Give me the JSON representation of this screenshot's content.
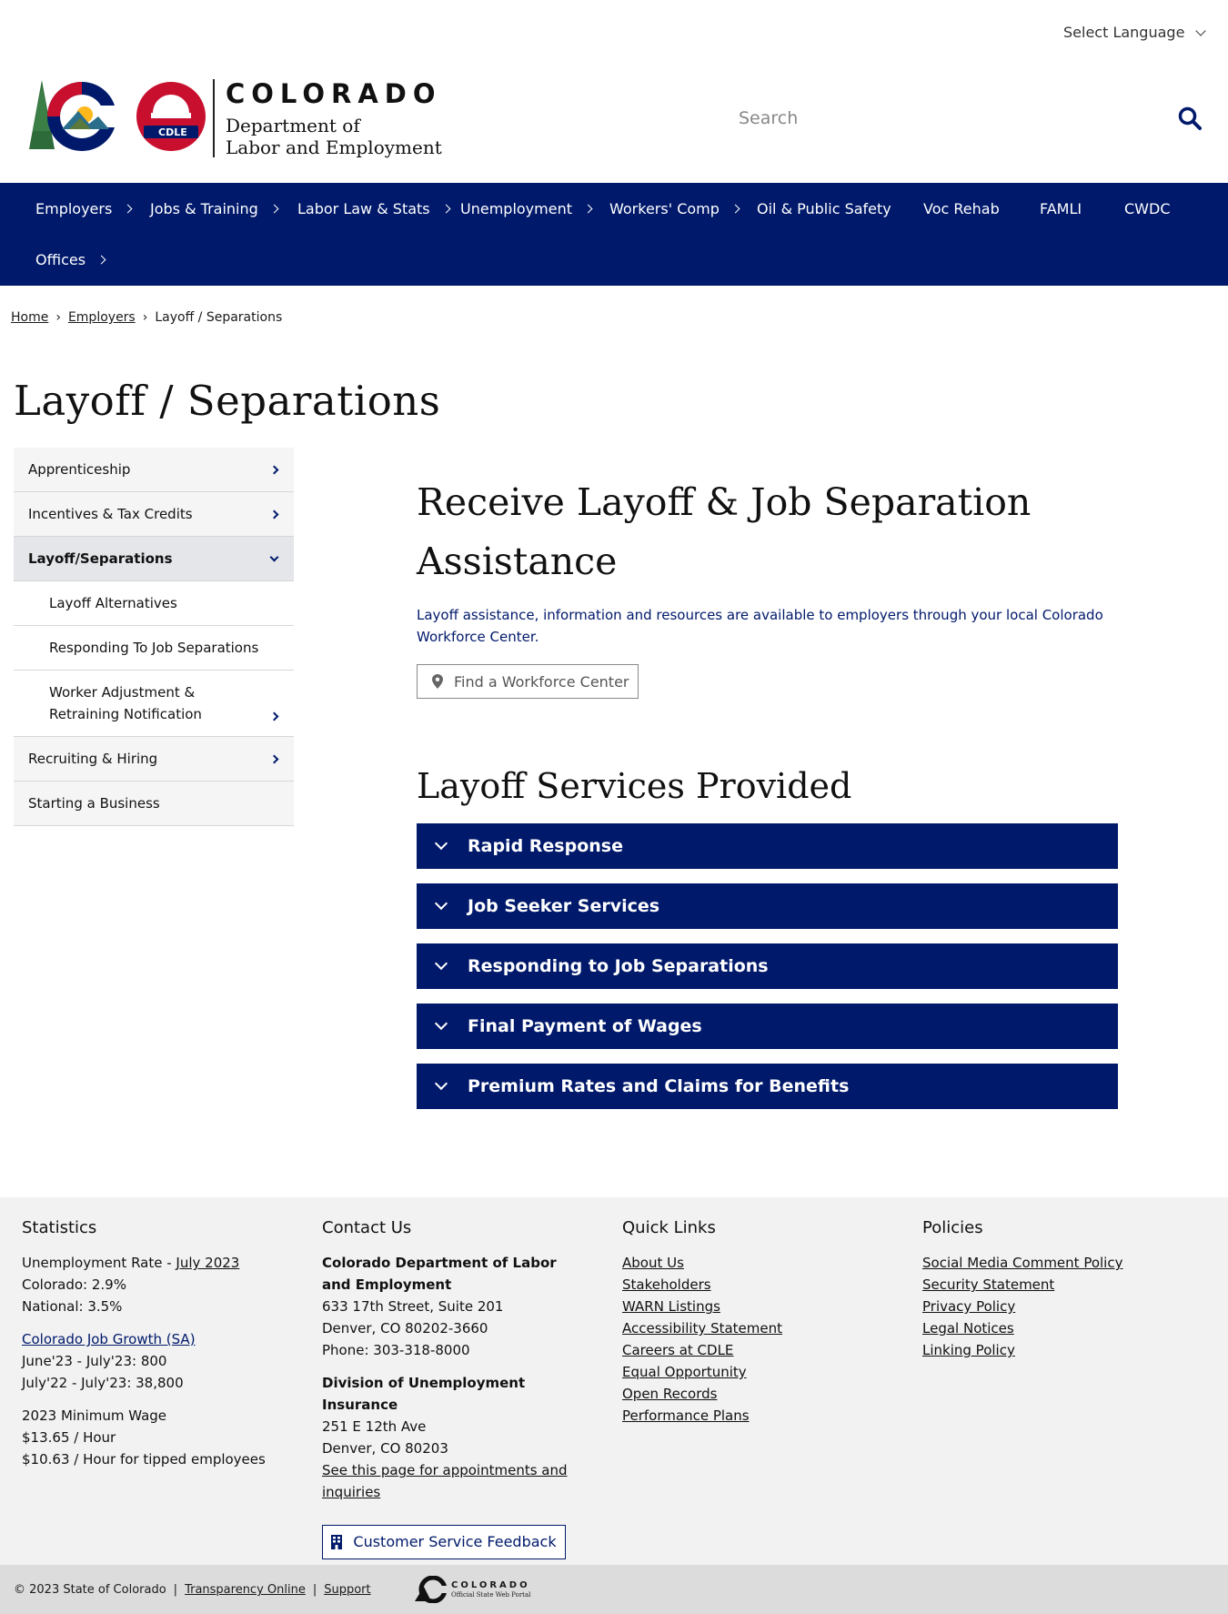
{
  "header": {
    "language_label": "Select Language",
    "logo_title": "COLORADO",
    "logo_sub_line1": "Department of",
    "logo_sub_line2": "Labor and Employment",
    "logo_badge": "CDLE",
    "search_placeholder": "Search"
  },
  "nav": {
    "items": [
      {
        "label": "Employers"
      },
      {
        "label": "Jobs & Training"
      },
      {
        "label": "Labor Law & Stats"
      },
      {
        "label": "Unemployment"
      },
      {
        "label": "Workers' Comp"
      },
      {
        "label": "Oil & Public Safety"
      },
      {
        "label": "Voc Rehab"
      },
      {
        "label": "FAMLI"
      },
      {
        "label": "CWDC"
      },
      {
        "label": "Offices"
      }
    ]
  },
  "breadcrumb": {
    "home": "Home",
    "employers": "Employers",
    "current": "Layoff / Separations"
  },
  "page_title": "Layoff / Separations",
  "sidebar": {
    "items": [
      {
        "label": "Apprenticeship"
      },
      {
        "label": "Incentives & Tax Credits"
      },
      {
        "label": "Layoff/Separations"
      },
      {
        "label": "Layoff Alternatives"
      },
      {
        "label": "Responding To Job Separations"
      },
      {
        "label": "Worker Adjustment & Retraining Notification"
      },
      {
        "label": "Recruiting & Hiring"
      },
      {
        "label": "Starting a Business"
      }
    ]
  },
  "main": {
    "heading": "Receive Layoff & Job Separation Assistance",
    "lead": "Layoff assistance, information and resources are available to employers through your local Colorado Workforce Center.",
    "find_button": "Find a Workforce Center",
    "services_heading": "Layoff Services Provided",
    "accordion": [
      {
        "label": "Rapid Response"
      },
      {
        "label": "Job Seeker Services"
      },
      {
        "label": "Responding to Job Separations"
      },
      {
        "label": "Final Payment of Wages"
      },
      {
        "label": "Premium Rates and Claims for Benefits"
      }
    ]
  },
  "footer": {
    "statistics": {
      "heading": "Statistics",
      "unemp_label": "Unemployment Rate - ",
      "unemp_link": "July 2023",
      "colorado": "Colorado: 2.9%",
      "national": "National: 3.5%",
      "growth_link": "Colorado Job Growth (SA)",
      "growth_1": "June'23 - July'23: 800",
      "growth_2": "July'22 - July'23: 38,800",
      "minwage_label": "2023 Minimum Wage",
      "minwage_1": "$13.65 / Hour",
      "minwage_2": "$10.63 / Hour for tipped employees"
    },
    "contact": {
      "heading": "Contact Us",
      "org": "Colorado Department of Labor and Employment",
      "addr1": "633 17th Street, Suite 201",
      "addr2": "Denver, CO  80202-3660",
      "phone": "Phone: 303-318-8000",
      "div": "Division of Unemployment Insurance",
      "div_addr1": "251 E 12th Ave",
      "div_addr2": "Denver, CO  80203",
      "appt_link": "See this page for appointments and inquiries",
      "feedback_button": "Customer Service Feedback"
    },
    "quick_links": {
      "heading": "Quick Links",
      "links": [
        "About Us",
        "Stakeholders",
        "WARN Listings",
        "Accessibility Statement",
        "Careers at CDLE",
        "Equal Opportunity",
        "Open Records",
        "Performance Plans"
      ]
    },
    "policies": {
      "heading": "Policies",
      "links": [
        "Social Media Comment Policy",
        "Security Statement",
        "Privacy Policy",
        "Legal Notices",
        "Linking Policy"
      ]
    }
  },
  "bottom": {
    "copyright": "© 2023 State of Colorado",
    "transparency": "Transparency Online",
    "support": "Support",
    "portal_title": "COLORADO",
    "portal_sub": "Official State Web Portal"
  }
}
